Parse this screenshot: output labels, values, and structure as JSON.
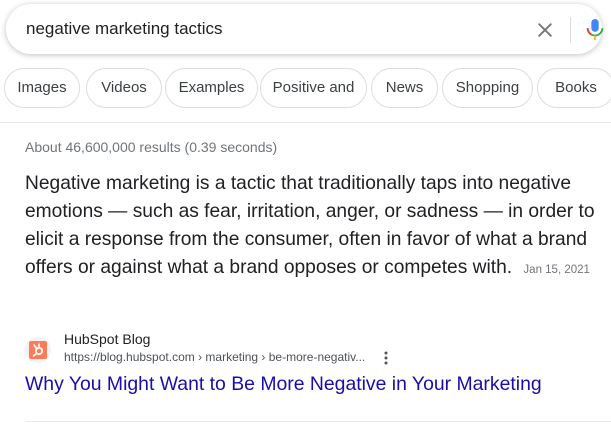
{
  "search": {
    "query": "negative marketing tactics"
  },
  "chips": [
    {
      "label": "Images"
    },
    {
      "label": "Videos"
    },
    {
      "label": "Examples"
    },
    {
      "label": "Positive and"
    },
    {
      "label": "News"
    },
    {
      "label": "Shopping"
    },
    {
      "label": "Books"
    }
  ],
  "results": {
    "stats": "About 46,600,000 results (0.39 seconds)",
    "featured_snippet": {
      "text": "Negative marketing is a tactic that traditionally taps into negative emotions — such as fear, irritation, anger, or sadness — in order to elicit a response from the consumer, often in favor of what a brand offers or against what a brand opposes or competes with.",
      "date": "Jan 15, 2021"
    },
    "source": {
      "site_name": "HubSpot Blog",
      "url": "https://blog.hubspot.com › marketing › be-more-negativ...",
      "title": "Why You Might Want to Be More Negative in Your Marketing"
    }
  },
  "colors": {
    "link": "#1a0dab",
    "text": "#202124",
    "muted": "#70757a",
    "hubspot": "#ff7a59"
  },
  "icons": {
    "clear": "close-icon",
    "mic": "microphone-icon",
    "favicon": "hubspot-logo-icon",
    "more": "more-vert-icon"
  }
}
